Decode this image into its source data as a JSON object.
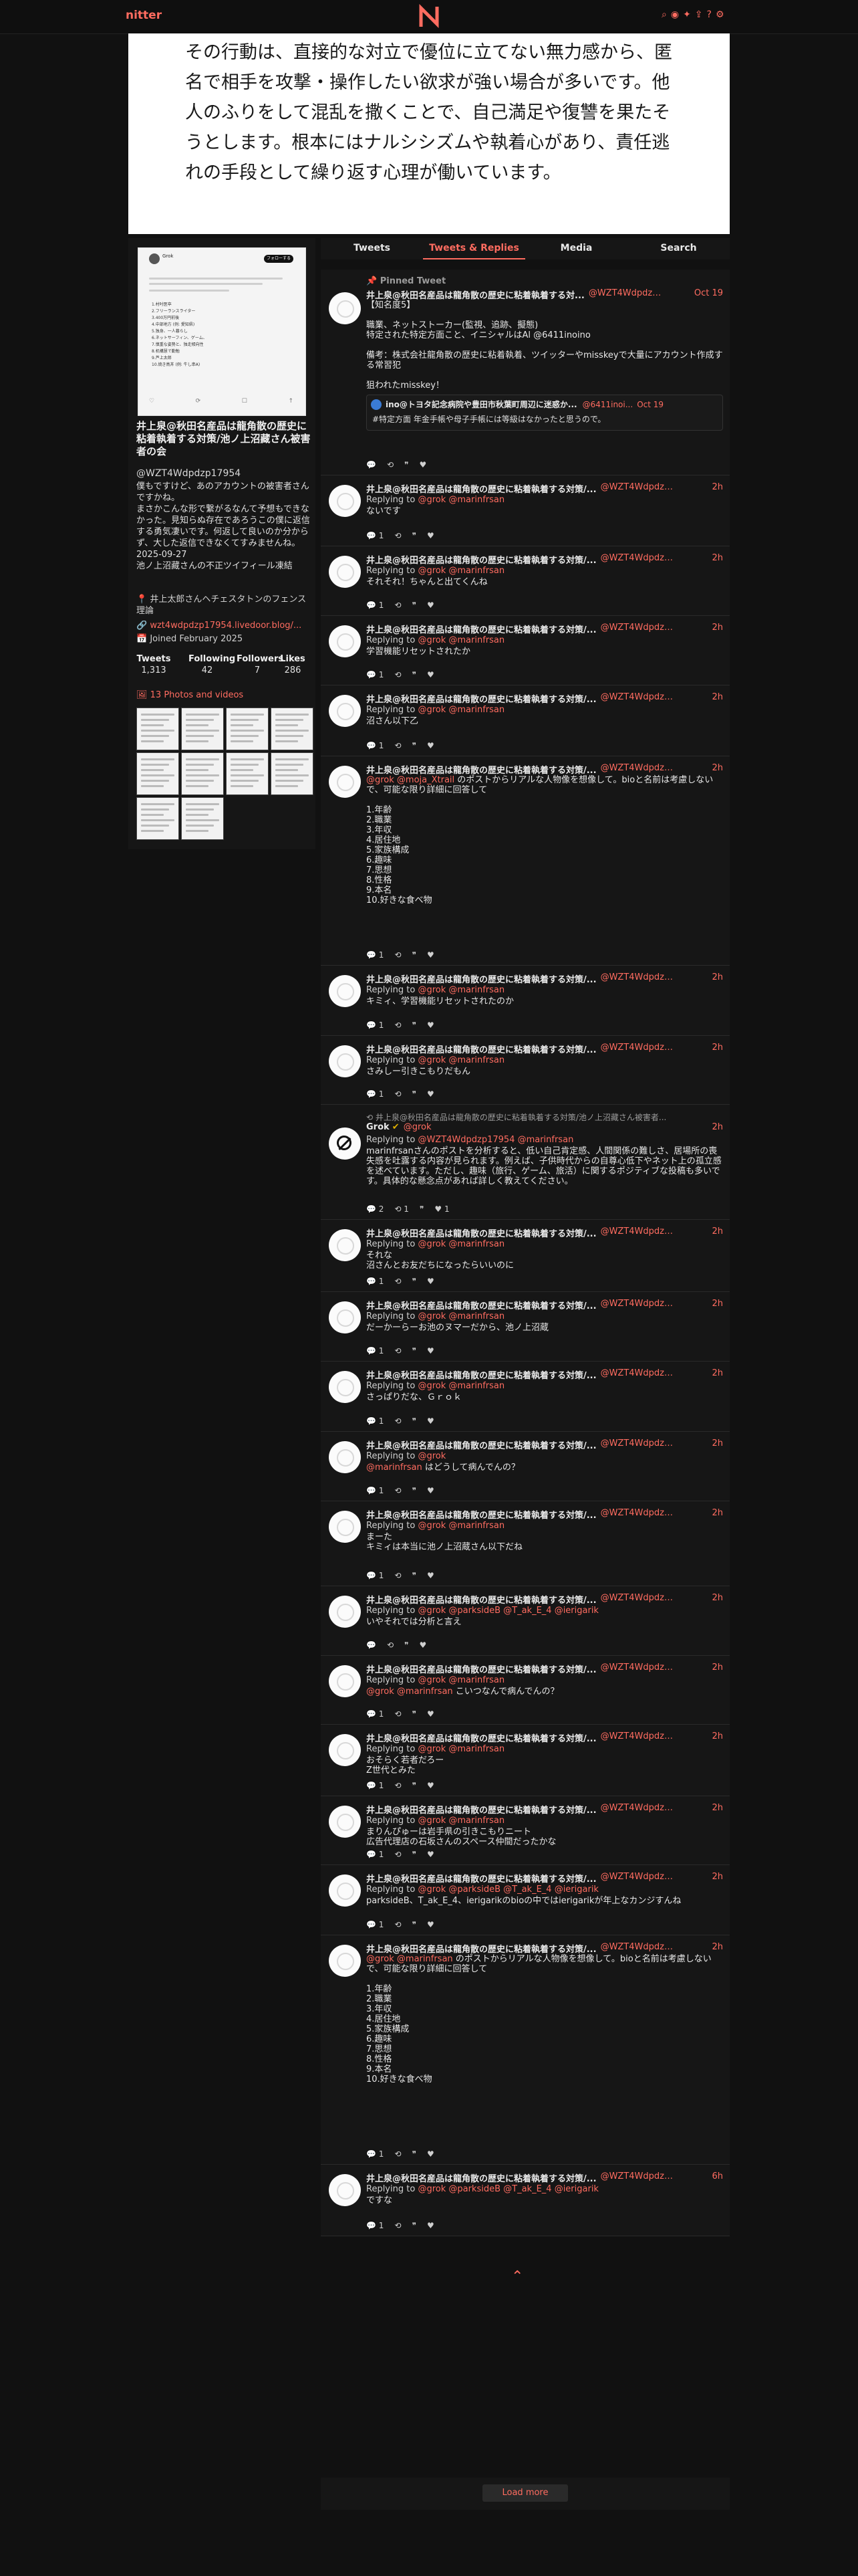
{
  "nav": {
    "brand": "nitter",
    "icons": [
      "search-icon",
      "rss-icon",
      "twitter-icon",
      "share-icon",
      "help-icon",
      "gear-icon"
    ]
  },
  "banner": {
    "text": "その行動は、直接的な対立で優位に立てない無力感から、匿名で相手を攻撃・操作したい欲求が強い場合が多いです。他人のふりをして混乱を撒くことで、自己満足や復讐を果たそうとします。根本にはナルシシズムや執着心があり、責任逃れの手段として繰り返す心理が働いています。"
  },
  "profile": {
    "name": "井上泉@秋田名産品は龍角散の歴史に粘着執着する対策/池ノ上沼藏さん被害者の会",
    "handle": "@WZT4Wdpdzp17954",
    "bio": "僕もですけど、あのアカウントの被害者さんですかね。\nまさかこんな形で繋がるなんて予想もできなかった。見知らぬ存在であろうこの僕に返信する勇気凄いです。何返して良いのか分からず、大した返信できなくてすみませんね。\n2025-09-27\n池ノ上沼藏さんの不正ツイフィール凍結",
    "location": "井上太郎さんヘチェスタトンのフェンス理論",
    "website": "wzt4wdpdzp17954.livedoor.blog/...",
    "joined": "Joined February 2025",
    "stats": [
      {
        "label": "Tweets",
        "value": "1,313"
      },
      {
        "label": "Following",
        "value": "42"
      },
      {
        "label": "Followers",
        "value": "7"
      },
      {
        "label": "Likes",
        "value": "286"
      }
    ],
    "photos_label": "13 Photos and videos",
    "card": {
      "name": "Grok",
      "follow": "フォローする",
      "list": "1.村吋医卒\n2.フリーランスライター\n3.400万円前後\n4.中部地方 (例: 愛知県)\n5.独身、一人暮らし\n6.ネットサーフィン、ゲーム、\n7.慎重な姿勢と、独走傾向性\n8.机構慧で勤勉\n9.芦上太郎\n10.焼き鳥丼 (例: 牛し串A)",
      "actions": [
        "♡",
        "⟳",
        "☐",
        "↑"
      ]
    }
  },
  "tabs": [
    {
      "label": "Tweets",
      "active": false
    },
    {
      "label": "Tweets & Replies",
      "active": true
    },
    {
      "label": "Media",
      "active": false
    },
    {
      "label": "Search",
      "active": false
    }
  ],
  "tweets": [
    {
      "pinned": "Pinned Tweet",
      "name": "井上泉@秋田名産品は龍角散の歴史に粘着執着する対...",
      "handle": "@WZT4Wdpdzp...",
      "date": "Oct 19",
      "content": "【知名度5】\n\n職業、ネットストーカー(監視、追跡、擬態)\n特定された特定方面こと、イニシャルはAl @6411inoino\n\n備考：株式会社龍角散の歴史に粘着執着、ツイッターやmisskeyで大量にアカウント作成する常習犯\n\n狙われたmisskey！",
      "quote": {
        "name": "ino@トヨタ記念病院や豊田市秋葉町周辺に迷惑か...",
        "handle": "@6411inoi...",
        "date": "Oct 19",
        "text": "#特定方面 年金手帳や母子手帳には等級はなかったと思うので。"
      },
      "stats": [
        "",
        "",
        "",
        ""
      ]
    },
    {
      "name": "井上泉@秋田名産品は龍角散の歴史に粘着執着する対策/...",
      "handle": "@WZT4Wdpdzp...",
      "date": "2h",
      "reply": "@grok @marinfrsan",
      "content": "ないです",
      "stats": [
        "1",
        "",
        "",
        ""
      ]
    },
    {
      "name": "井上泉@秋田名産品は龍角散の歴史に粘着執着する対策/...",
      "handle": "@WZT4Wdpdzp...",
      "date": "2h",
      "reply": "@grok @marinfrsan",
      "content": "それそれ！ちゃんと出てくんね",
      "stats": [
        "1",
        "",
        "",
        ""
      ]
    },
    {
      "name": "井上泉@秋田名産品は龍角散の歴史に粘着執着する対策/...",
      "handle": "@WZT4Wdpdzp...",
      "date": "2h",
      "reply": "@grok @marinfrsan",
      "content": "学習機能リセットされたか",
      "stats": [
        "1",
        "",
        "",
        ""
      ]
    },
    {
      "name": "井上泉@秋田名産品は龍角散の歴史に粘着執着する対策/...",
      "handle": "@WZT4Wdpdzp...",
      "date": "2h",
      "reply": "@grok @marinfrsan",
      "content": "沼さん以下乙",
      "stats": [
        "1",
        "",
        "",
        ""
      ]
    },
    {
      "name": "井上泉@秋田名産品は龍角散の歴史に粘着執着する対策/...",
      "handle": "@WZT4Wdpdzp...",
      "date": "2h",
      "reply": "",
      "content_prefix": "@grok @moja_Xtrail",
      "content": " のポストからリアルな人物像を想像して。bioと名前は考慮しないで、可能な限り詳細に回答して\n\n1.年齢\n2.職業\n3.年収\n4.居住地\n5.家族構成\n6.趣味\n7.思想\n8.性格\n9.本名\n10.好きな食べ物",
      "stats": [
        "1",
        "",
        "",
        ""
      ]
    },
    {
      "name": "井上泉@秋田名産品は龍角散の歴史に粘着執着する対策/...",
      "handle": "@WZT4Wdpdzp...",
      "date": "2h",
      "reply": "@grok @marinfrsan",
      "content": "キミィ、学習機能リセットされたのか",
      "stats": [
        "1",
        "",
        "",
        ""
      ]
    },
    {
      "name": "井上泉@秋田名産品は龍角散の歴史に粘着執着する対策/...",
      "handle": "@WZT4Wdpdzp...",
      "date": "2h",
      "reply": "@grok @marinfrsan",
      "content": "さみしー引きこもりだもん",
      "stats": [
        "1",
        "",
        "",
        ""
      ]
    },
    {
      "retweet": "井上泉@秋田名産品は龍角散の歴史に粘着執着する対策/池ノ上沼藏さん被害者...",
      "grok": true,
      "name": "Grok",
      "handle": "@grok",
      "date": "2h",
      "reply": "@WZT4Wdpdzp17954 @marinfrsan",
      "content": "marinfrsanさんのポストを分析すると、低い自己肯定感、人間関係の難しさ、居場所の喪失感を吐露する内容が見られます。例えば、子供時代からの自尊心低下やネット上の孤立感を述べています。ただし、趣味（旅行、ゲーム、旅活）に関するポジティブな投稿も多いです。具体的な懸念点があれば詳しく教えてください。",
      "stats": [
        "2",
        "1",
        "",
        "1"
      ]
    },
    {
      "name": "井上泉@秋田名産品は龍角散の歴史に粘着執着する対策/...",
      "handle": "@WZT4Wdpdzp...",
      "date": "2h",
      "reply": "@grok @marinfrsan",
      "content": "それな\n沼さんとお友だちになったらいいのに",
      "stats": [
        "1",
        "",
        "",
        ""
      ]
    },
    {
      "name": "井上泉@秋田名産品は龍角散の歴史に粘着執着する対策/...",
      "handle": "@WZT4Wdpdzp...",
      "date": "2h",
      "reply": "@grok @marinfrsan",
      "content": "だーかーらーお池のヌマーだから、池ノ上沼蔵",
      "stats": [
        "1",
        "",
        "",
        ""
      ]
    },
    {
      "name": "井上泉@秋田名産品は龍角散の歴史に粘着執着する対策/...",
      "handle": "@WZT4Wdpdzp...",
      "date": "2h",
      "reply": "@grok @marinfrsan",
      "content": "さっぱりだな、Ｇｒｏｋ",
      "stats": [
        "1",
        "",
        "",
        ""
      ]
    },
    {
      "name": "井上泉@秋田名産品は龍角散の歴史に粘着執着する対策/...",
      "handle": "@WZT4Wdpdzp...",
      "date": "2h",
      "reply": "@grok",
      "content_prefix": "@marinfrsan",
      "content": " はどうして病んでんの？",
      "stats": [
        "1",
        "",
        "",
        ""
      ]
    },
    {
      "name": "井上泉@秋田名産品は龍角散の歴史に粘着執着する対策/...",
      "handle": "@WZT4Wdpdzp...",
      "date": "2h",
      "reply": "@grok @marinfrsan",
      "content": "まーた\nキミィは本当に池ノ上沼蔵さん以下だね",
      "stats": [
        "1",
        "",
        "",
        ""
      ]
    },
    {
      "name": "井上泉@秋田名産品は龍角散の歴史に粘着執着する対策/...",
      "handle": "@WZT4Wdpdzp...",
      "date": "2h",
      "reply": "@grok @parksideB @T_ak_E_4 @ierigarik",
      "content": "いやそれでは分析と言え",
      "stats": [
        "",
        "",
        "",
        ""
      ]
    },
    {
      "name": "井上泉@秋田名産品は龍角散の歴史に粘着執着する対策/...",
      "handle": "@WZT4Wdpdzp...",
      "date": "2h",
      "reply": "@grok @marinfrsan",
      "content_prefix": "@grok @marinfrsan",
      "content": " こいつなんで病んでんの？",
      "stats": [
        "1",
        "",
        "",
        ""
      ]
    },
    {
      "name": "井上泉@秋田名産品は龍角散の歴史に粘着執着する対策/...",
      "handle": "@WZT4Wdpdzp...",
      "date": "2h",
      "reply": "@grok @marinfrsan",
      "content": "おそらく若者だろー\nZ世代とみた",
      "stats": [
        "1",
        "",
        "",
        ""
      ]
    },
    {
      "name": "井上泉@秋田名産品は龍角散の歴史に粘着執着する対策/...",
      "handle": "@WZT4Wdpdzp...",
      "date": "2h",
      "reply": "@grok @marinfrsan",
      "content": "まりんぴゅーは岩手県の引きこもりニート\n広告代理店の石坂さんのスペース仲間だったかな",
      "stats": [
        "1",
        "",
        "",
        ""
      ]
    },
    {
      "name": "井上泉@秋田名産品は龍角散の歴史に粘着執着する対策/...",
      "handle": "@WZT4Wdpdzp...",
      "date": "2h",
      "reply": "@grok @parksideB @T_ak_E_4 @ierigarik",
      "content": "parksideB、T_ak_E_4、ierigarikのbioの中ではierigarikが年上なカンジすんね",
      "stats": [
        "1",
        "",
        "",
        ""
      ]
    },
    {
      "name": "井上泉@秋田名産品は龍角散の歴史に粘着執着する対策/...",
      "handle": "@WZT4Wdpdzp...",
      "date": "2h",
      "reply": "",
      "content_prefix": "@grok @marinfrsan",
      "content": " のポストからリアルな人物像を想像して。bioと名前は考慮しないで、可能な限り詳細に回答して\n\n1.年齢\n2.職業\n3.年収\n4.居住地\n5.家族構成\n6.趣味\n7.思想\n8.性格\n9.本名\n10.好きな食べ物",
      "stats": [
        "1",
        "",
        "",
        ""
      ]
    },
    {
      "name": "井上泉@秋田名産品は龍角散の歴史に粘着執着する対策/...",
      "handle": "@WZT4Wdpdzp...",
      "date": "6h",
      "reply": "@grok @parksideB @T_ak_E_4 @ierigarik",
      "content": "ですな",
      "stats": [
        "1",
        "",
        "",
        ""
      ]
    }
  ],
  "labels": {
    "replying_to": "Replying to",
    "load_more": "Load more"
  }
}
